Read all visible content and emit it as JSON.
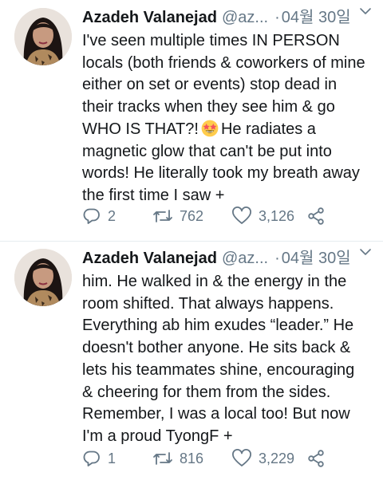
{
  "tweets": [
    {
      "author_name": "Azadeh Valanejad",
      "handle": "@az...",
      "separator": "·",
      "date": "04월 30일",
      "text_before_emoji": "I've seen multiple times IN PERSON locals (both friends & coworkers of mine either on set or events) stop dead in their tracks when they see him & go WHO IS THAT?!",
      "emoji": "star-struck-emoji",
      "text_after_emoji": "He radiates a magnetic glow that can't be put into words! He literally took my breath away the first time I saw +",
      "replies": "2",
      "retweets": "762",
      "likes": "3,126"
    },
    {
      "author_name": "Azadeh Valanejad",
      "handle": "@az...",
      "separator": "·",
      "date": "04월 30일",
      "text": "him. He walked in & the energy in the room shifted. That always happens. Everything ab him exudes “leader.” He doesn't bother anyone. He sits back & lets his teammates shine, encouraging & cheering for them from the sides. Remember, I was a local too! But now I'm a proud TyongF +",
      "replies": "1",
      "retweets": "816",
      "likes": "3,229"
    }
  ],
  "icons": {
    "reply": "reply-icon",
    "retweet": "retweet-icon",
    "like": "heart-icon",
    "share": "share-icon",
    "menu": "chevron-down-icon"
  },
  "colors": {
    "text": "#14171a",
    "muted": "#657786",
    "divider": "#e6ecf0",
    "emoji_face": "#ffcc4d",
    "emoji_star": "#f4515e"
  }
}
